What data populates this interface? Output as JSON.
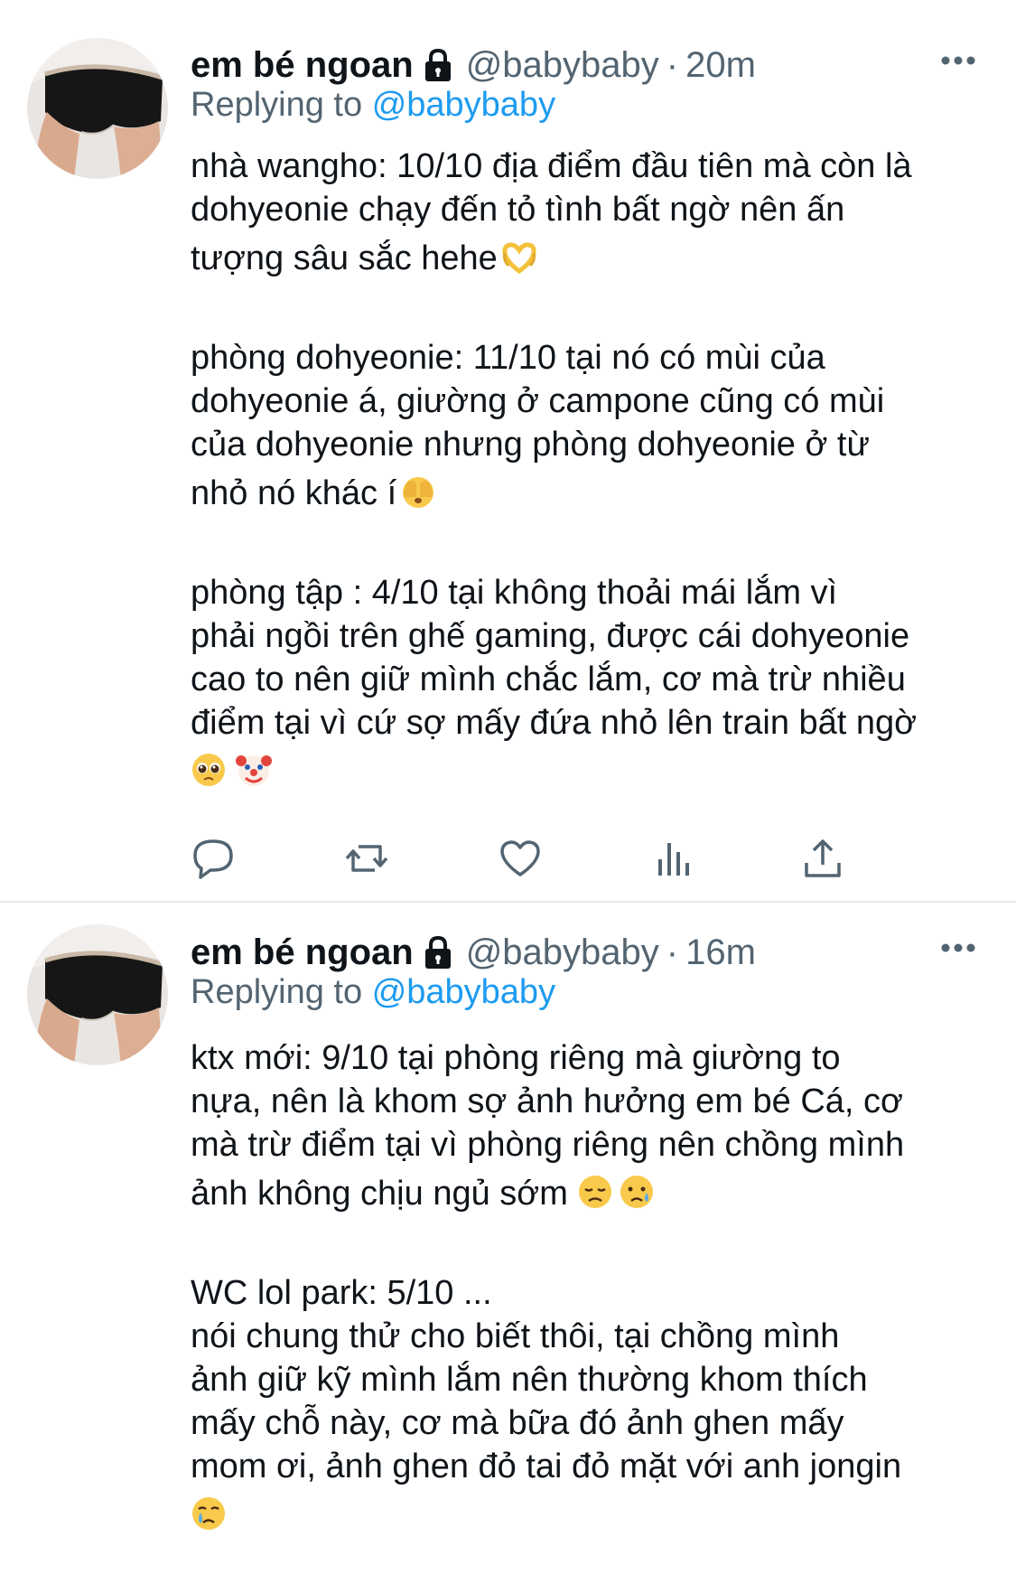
{
  "tweets": [
    {
      "display_name": "em bé ngoan",
      "handle": "@babybaby",
      "separator": "·",
      "time": "20m",
      "replying_prefix": "Replying to",
      "replying_to": "@babybaby",
      "paragraphs": [
        {
          "lines": [
            "nhà wangho: 10/10 địa điểm đầu tiên mà còn là",
            "dohyeonie chạy đến tỏ tình bất ngờ nên ấn",
            "tượng sâu sắc hehe"
          ],
          "emojis": [
            "heart-hands"
          ]
        },
        {
          "lines": [
            "phòng dohyeonie: 11/10 tại nó có mùi của",
            "dohyeonie á, giường ở campone cũng có mùi",
            "của dohyeonie nhưng phòng dohyeonie ở từ",
            "nhỏ nó khác í"
          ],
          "emojis": [
            "face-with-hands-over-eyes"
          ]
        },
        {
          "lines": [
            "phòng tập : 4/10 tại không thoải mái lắm vì",
            "phải ngồi trên ghế gaming, được cái dohyeonie",
            "cao to nên giữ mình chắc lắm, cơ mà trừ nhiều",
            "điểm tại vì cứ sợ mấy đứa nhỏ lên train bất ngờ",
            ""
          ],
          "emojis": [
            "pleading-face",
            "clown-face"
          ]
        }
      ],
      "actions": [
        "reply-icon",
        "retweet-icon",
        "like-icon",
        "views-icon",
        "share-icon"
      ]
    },
    {
      "display_name": "em bé ngoan",
      "handle": "@babybaby",
      "separator": "·",
      "time": "16m",
      "replying_prefix": "Replying to",
      "replying_to": "@babybaby",
      "paragraphs": [
        {
          "lines": [
            "ktx mới: 9/10 tại phòng riêng mà giường to",
            "nựa, nên là khom sợ ảnh hưởng em bé Cá, cơ",
            "mà trừ điểm tại vì phòng riêng nên chồng mình",
            "ảnh không chịu ngủ sớm"
          ],
          "emojis": [
            "disappointed-face",
            "sad-tear-face"
          ]
        },
        {
          "lines": [
            "WC lol park: 5/10 ...",
            "nói chung thử cho biết thôi, tại chồng mình",
            "ảnh giữ kỹ mình lắm nên thường khom thích",
            "mấy chỗ này, cơ mà bữa đó ảnh ghen mấy",
            "mom ơi, ảnh ghen đỏ tai đỏ mặt với anh jongin",
            ""
          ],
          "emojis": [
            "crying-face"
          ]
        }
      ]
    }
  ]
}
